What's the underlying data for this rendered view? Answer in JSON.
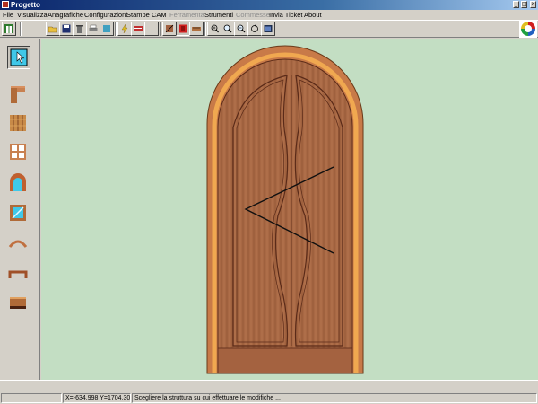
{
  "window": {
    "title": "Progetto",
    "minimize_glyph": "_",
    "maximize_glyph": "□",
    "close_glyph": "x"
  },
  "menu": [
    {
      "label": "File",
      "enabled": true
    },
    {
      "label": "Visualizza",
      "enabled": true
    },
    {
      "label": "Anagrafiche",
      "enabled": true
    },
    {
      "label": "Configurazioni",
      "enabled": true
    },
    {
      "label": "Stampe",
      "enabled": true
    },
    {
      "label": "CAM",
      "enabled": true
    },
    {
      "label": "Ferramenta",
      "enabled": false
    },
    {
      "label": "Strumenti",
      "enabled": true
    },
    {
      "label": "Commesse",
      "enabled": false
    },
    {
      "label": "Invia Ticket",
      "enabled": true
    },
    {
      "label": "About",
      "enabled": true
    }
  ],
  "toolbar": {
    "buttons": [
      {
        "icon": "layout-icon",
        "name": "layout-button"
      },
      {
        "icon": "open-folder-icon",
        "name": "open-button"
      },
      {
        "icon": "save-icon",
        "name": "save-button"
      },
      {
        "icon": "delete-icon",
        "name": "delete-button"
      },
      {
        "icon": "print-icon",
        "name": "print-button"
      },
      {
        "icon": "export-icon",
        "name": "export-button"
      },
      {
        "icon": "lightning-icon",
        "name": "generate-button"
      },
      {
        "icon": "truck-icon",
        "name": "transport-button"
      },
      {
        "icon": "blank-icon",
        "name": "blank-button"
      },
      {
        "icon": "dimension-icon",
        "name": "dimension-button"
      },
      {
        "icon": "door-red-icon",
        "name": "door-view-button",
        "pressed": true
      },
      {
        "icon": "measure-icon",
        "name": "measure-button"
      },
      {
        "icon": "zoom-window-icon",
        "name": "zoom-window-button"
      },
      {
        "icon": "zoom-in-icon",
        "name": "zoom-in-button"
      },
      {
        "icon": "zoom-out-icon",
        "name": "zoom-out-button"
      },
      {
        "icon": "refresh-icon",
        "name": "refresh-button"
      },
      {
        "icon": "picture-icon",
        "name": "picture-button"
      }
    ],
    "logo_icon": "company-logo-icon"
  },
  "tools": [
    {
      "icon": "select-arrow-icon",
      "name": "tool-select",
      "selected": true
    },
    {
      "icon": "frame-profile-icon",
      "name": "tool-frame"
    },
    {
      "icon": "panel-wood-icon",
      "name": "tool-panel"
    },
    {
      "icon": "split-grid-icon",
      "name": "tool-split"
    },
    {
      "icon": "arch-icon",
      "name": "tool-arch"
    },
    {
      "icon": "glass-icon",
      "name": "tool-glass"
    },
    {
      "icon": "arc-curve-icon",
      "name": "tool-arc"
    },
    {
      "icon": "bent-bar-icon",
      "name": "tool-bent-bar"
    },
    {
      "icon": "threshold-icon",
      "name": "tool-threshold"
    }
  ],
  "colors": {
    "canvas_bg": "#c3dec3",
    "frame_outer": "#c87a48",
    "frame_inner": "#e8a050",
    "door_wood": "#a06040",
    "panel_line": "#5a2a18"
  },
  "status": {
    "coordinates": "X=-634,998 Y=1704,307",
    "message": "Scegliere la struttura su cui effettuare le modifiche ..."
  }
}
